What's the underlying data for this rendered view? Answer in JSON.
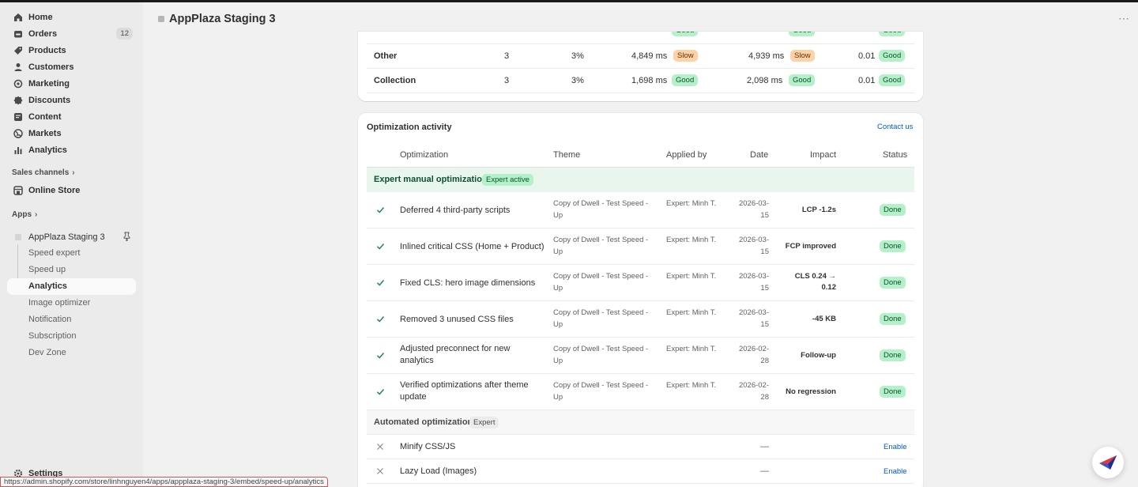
{
  "sidebar": {
    "nav": [
      {
        "label": "Home",
        "icon": "home-icon"
      },
      {
        "label": "Orders",
        "icon": "orders-icon",
        "badge": "12"
      },
      {
        "label": "Products",
        "icon": "tag-icon"
      },
      {
        "label": "Customers",
        "icon": "person-icon"
      },
      {
        "label": "Marketing",
        "icon": "target-icon"
      },
      {
        "label": "Discounts",
        "icon": "discount-icon"
      },
      {
        "label": "Content",
        "icon": "content-icon"
      },
      {
        "label": "Markets",
        "icon": "globe-icon"
      },
      {
        "label": "Analytics",
        "icon": "bar-chart-icon"
      }
    ],
    "sales_channels": "Sales channels",
    "online_store": "Online Store",
    "apps": "Apps",
    "app_name": "AppPlaza Staging 3",
    "app_subitems": [
      "Speed expert",
      "Speed up",
      "Analytics",
      "Image optimizer",
      "Notification",
      "Subscription",
      "Dev Zone"
    ],
    "settings": "Settings",
    "status_url": "https://admin.shopify.com/store/linhnguyen4/apps/appplaza-staging-3/embed/speed-up/analytics"
  },
  "header": {
    "title": "AppPlaza Staging 3",
    "more": "⋯"
  },
  "perf_table": {
    "rows": [
      {
        "page": "Other",
        "count": "3",
        "share": "3%",
        "lcp": "4,849 ms",
        "lcp_status": "Slow",
        "fcp": "4,939 ms",
        "fcp_status": "Slow",
        "cls": "0.01",
        "cls_status": "Good"
      },
      {
        "page": "Collection",
        "count": "3",
        "share": "3%",
        "lcp": "1,698 ms",
        "lcp_status": "Good",
        "fcp": "2,098 ms",
        "fcp_status": "Good",
        "cls": "0.01",
        "cls_status": "Good"
      }
    ]
  },
  "activity": {
    "title": "Optimization activity",
    "contact": "Contact us",
    "headers": {
      "optimization": "Optimization",
      "theme": "Theme",
      "applied_by": "Applied by",
      "date": "Date",
      "impact": "Impact",
      "status": "Status"
    },
    "manual_group": {
      "label": "Expert manual optimization",
      "badge": "Expert active"
    },
    "manual_rows": [
      {
        "name": "Deferred 4 third-party scripts",
        "theme": "Copy of Dwell - Test Speed - Up",
        "by": "Expert: Minh T.",
        "date": "2026-03-15",
        "impact": "LCP -1.2s",
        "status": "Done"
      },
      {
        "name": "Inlined critical CSS (Home + Product)",
        "theme": "Copy of Dwell - Test Speed - Up",
        "by": "Expert: Minh T.",
        "date": "2026-03-15",
        "impact": "FCP improved",
        "status": "Done"
      },
      {
        "name": "Fixed CLS: hero image dimensions",
        "theme": "Copy of Dwell - Test Speed - Up",
        "by": "Expert: Minh T.",
        "date": "2026-03-15",
        "impact": "CLS 0.24 → 0.12",
        "status": "Done"
      },
      {
        "name": "Removed 3 unused CSS files",
        "theme": "Copy of Dwell - Test Speed - Up",
        "by": "Expert: Minh T.",
        "date": "2026-03-15",
        "impact": "-45 KB",
        "status": "Done"
      },
      {
        "name": "Adjusted preconnect for new analytics",
        "theme": "Copy of Dwell - Test Speed - Up",
        "by": "Expert: Minh T.",
        "date": "2026-02-28",
        "impact": "Follow-up",
        "status": "Done"
      },
      {
        "name": "Verified optimizations after theme update",
        "theme": "Copy of Dwell - Test Speed - Up",
        "by": "Expert: Minh T.",
        "date": "2026-02-28",
        "impact": "No regression",
        "status": "Done"
      }
    ],
    "auto_group": {
      "label": "Automated optimization",
      "badge": "Expert"
    },
    "auto_rows": [
      {
        "name": "Minify CSS/JS",
        "date": "—",
        "action": "Enable"
      },
      {
        "name": "Lazy Load (Images)",
        "date": "—",
        "action": "Enable"
      }
    ]
  },
  "colors": {
    "good": "#b4f0c8",
    "slow": "#fed1a7",
    "link": "#005bd3",
    "check": "#29845a"
  }
}
